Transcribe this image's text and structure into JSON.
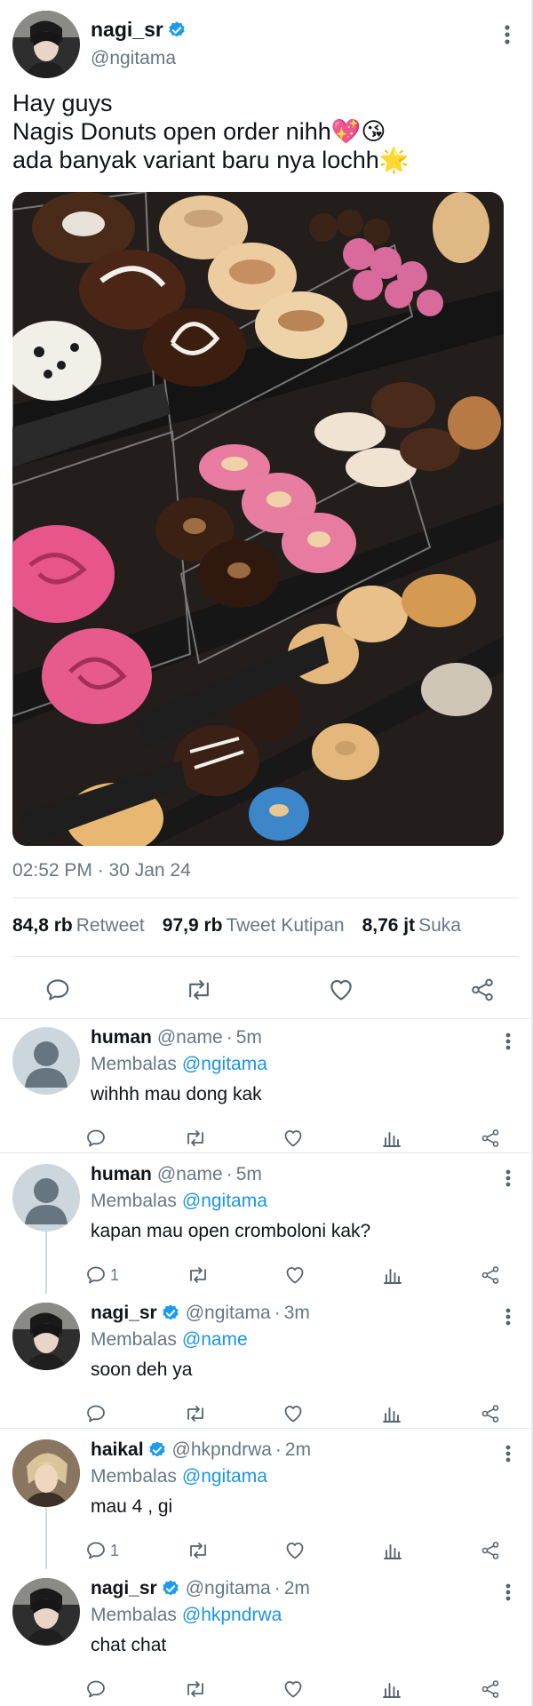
{
  "tweet": {
    "display_name": "nagi_sr",
    "handle": "@ngitama",
    "verified": true,
    "text_lines": [
      "Hay guys",
      "Nagis Donuts open order nihh💖😘",
      "ada banyak variant baru nya lochh🌟"
    ],
    "media_alt": "Donut display case",
    "timestamp": "02:52 PM · 30 Jan 24",
    "stats": [
      {
        "value": "84,8 rb",
        "label": "Retweet"
      },
      {
        "value": "97,9 rb",
        "label": "Tweet Kutipan"
      },
      {
        "value": "8,76 jt",
        "label": "Suka"
      }
    ],
    "icons": [
      "reply-icon",
      "retweet-icon",
      "like-icon",
      "share-icon",
      "more-icon"
    ]
  },
  "replies": [
    {
      "display_name": "human",
      "verified": false,
      "handle": "@name",
      "time": "5m",
      "replying_label": "Membalas",
      "replying_to": "@ngitama",
      "text": "wihhh mau dong kak",
      "reply_count": ""
    },
    {
      "display_name": "human",
      "verified": false,
      "handle": "@name",
      "time": "5m",
      "replying_label": "Membalas",
      "replying_to": "@ngitama",
      "text": "kapan mau open cromboloni kak?",
      "reply_count": "1"
    },
    {
      "display_name": "nagi_sr",
      "verified": true,
      "handle": "@ngitama",
      "time": "3m",
      "replying_label": "Membalas",
      "replying_to": "@name",
      "text": "soon deh ya",
      "reply_count": ""
    },
    {
      "display_name": "haikal",
      "verified": true,
      "handle": "@hkpndrwa",
      "time": "2m",
      "replying_label": "Membalas",
      "replying_to": "@ngitama",
      "text": "mau 4 , gi",
      "reply_count": "1"
    },
    {
      "display_name": "nagi_sr",
      "verified": true,
      "handle": "@ngitama",
      "time": "2m",
      "replying_label": "Membalas",
      "replying_to": "@hkpndrwa",
      "text": "chat chat",
      "reply_count": ""
    }
  ],
  "colors": {
    "verified_blue": "#1d9bf0",
    "mention_blue": "#1b95e0",
    "muted_text": "#657786",
    "primary_text": "#0f1419"
  }
}
